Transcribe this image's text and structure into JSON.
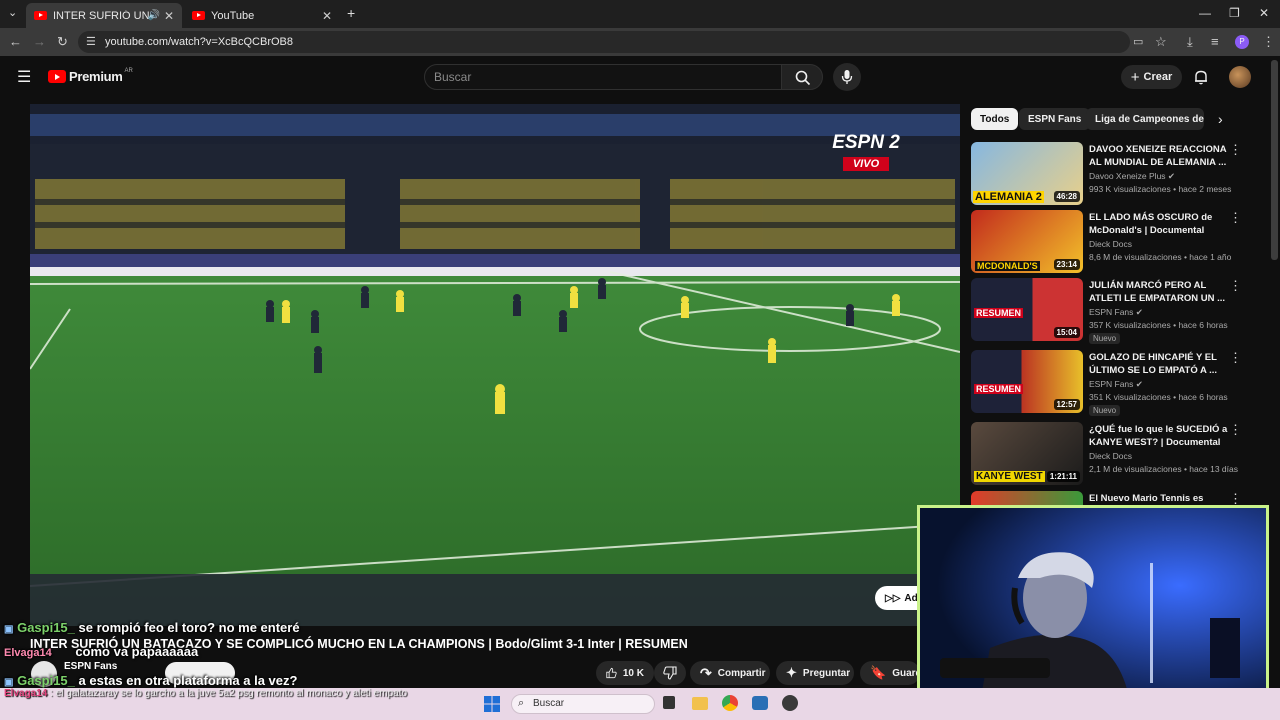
{
  "browser": {
    "tabs": [
      {
        "title": "INTER SUFRIÓ UN BATACA",
        "active": true
      },
      {
        "title": "YouTube",
        "active": false
      }
    ],
    "url": "youtube.com/watch?v=XcBcQCBrOB8"
  },
  "header": {
    "logo": "Premium",
    "region": "AR",
    "search_placeholder": "Buscar",
    "create_label": "Crear"
  },
  "video": {
    "broadcaster": "ESPN 2",
    "live_label": "VIVO",
    "add_label": "Add",
    "title": "INTER SUFRIÓ UN BATACAZO Y SE COMPLICÓ MUCHO EN LA CHAMPIONS | Bodo/Glimt 3-1 Inter | RESUMEN",
    "channel": "ESPN Fans",
    "actions": {
      "likes": "10 K",
      "share": "Compartir",
      "ask": "Preguntar",
      "save": "Guardar"
    }
  },
  "chips": [
    "Todos",
    "ESPN Fans",
    "Liga de Campeones de la UEFA"
  ],
  "recommendations": [
    {
      "title": "DAVOO XENEIZE REACCIONA AL MUNDIAL DE ALEMANIA ...",
      "channel": "Davoo Xeneize Plus",
      "meta": "993 K visualizaciones • hace 2 meses",
      "duration": "46:28",
      "thumb": "ALEMANIA 2",
      "new": ""
    },
    {
      "title": "EL LADO MÁS OSCURO de McDonald's | Documental",
      "channel": "Dieck Docs",
      "meta": "8,6 M de visualizaciones • hace 1 año",
      "duration": "23:14",
      "thumb": "MCDONALD'S",
      "new": ""
    },
    {
      "title": "JULIÁN MARCÓ PERO AL ATLETI LE EMPATARON UN ...",
      "channel": "ESPN Fans",
      "meta": "357 K visualizaciones • hace 6 horas",
      "duration": "15:04",
      "thumb": "RESUMEN",
      "new": "Nuevo"
    },
    {
      "title": "GOLAZO DE HINCAPIÉ Y EL ÚLTIMO SE LO EMPATÓ A ...",
      "channel": "ESPN Fans",
      "meta": "351 K visualizaciones • hace 6 horas",
      "duration": "12:57",
      "thumb": "RESUMEN",
      "new": "Nuevo"
    },
    {
      "title": "¿QUÉ fue lo que le SUCEDIÓ a KANYE WEST? | Documental",
      "channel": "Dieck Docs",
      "meta": "2,1 M de visualizaciones • hace 13 días",
      "duration": "1:21:11",
      "thumb": "KANYE WEST",
      "new": ""
    },
    {
      "title": "El Nuevo Mario Tennis es",
      "channel": "",
      "meta": "",
      "duration": "",
      "thumb": "",
      "new": ""
    }
  ],
  "chat": [
    {
      "user": "Gaspi15_",
      "msg": "se rompió feo el toro? no me enteré"
    },
    {
      "user": "Elvaga14",
      "msg": "como va papaaaaaa"
    },
    {
      "user": "Gaspi15_",
      "msg": "a estas en otra plataforma a la vez?"
    },
    {
      "user": "Elvaga14",
      "msg": "el galatazaray se lo garcho a la juve 5a2 psg remonto al monaco y aleti empato"
    }
  ],
  "taskbar": {
    "search_placeholder": "Buscar"
  },
  "colors": {
    "accent": "#ff0000",
    "cam_border": "#c9f28a",
    "pitch": "#2e6a2a"
  }
}
